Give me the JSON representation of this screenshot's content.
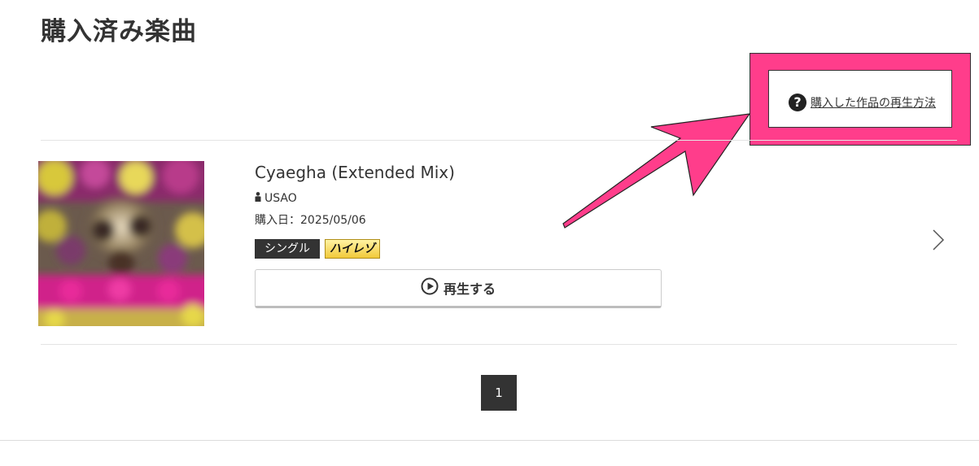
{
  "page": {
    "title": "購入済み楽曲"
  },
  "help": {
    "icon": "question-circle-icon",
    "label": "購入した作品の再生方法",
    "highlight_color": "#ff3d8b"
  },
  "track": {
    "title": "Cyaegha (Extended Mix)",
    "artist": "USAO",
    "purchase_date": "購入日：2025/05/06",
    "tags": {
      "single": "シングル",
      "hires": "ハイレゾ"
    },
    "play_label": "再生する"
  },
  "pagination": {
    "current": "1"
  },
  "colors": {
    "text": "#333333",
    "annotation": "#ff3d8b",
    "tag_dark": "#333333",
    "hires_gold": "#f1c93a"
  }
}
